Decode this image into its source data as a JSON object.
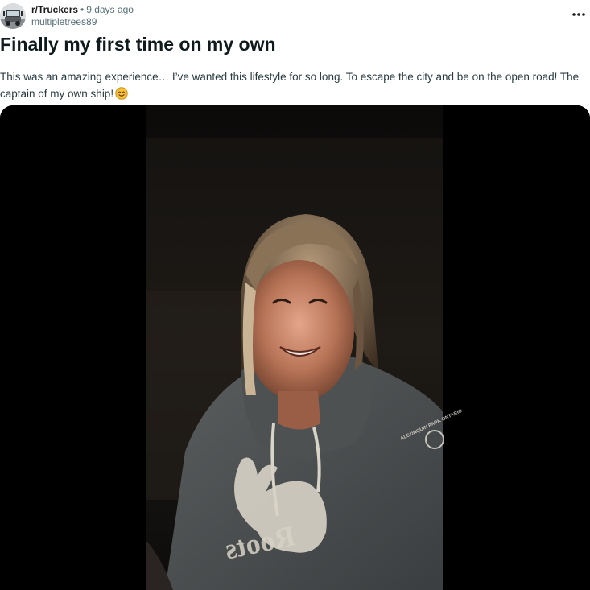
{
  "post": {
    "subreddit": "r/Truckers",
    "separator": "•",
    "time": "9 days ago",
    "username": "multipletrees89",
    "title": "Finally my first time on my own",
    "body": "This was an amazing experience… I’ve wanted this lifestyle for so long. To escape the city and be on the open road! The captain of my own ship!",
    "emoji": "smiling-face-icon"
  },
  "media": {
    "type": "video",
    "hoodie_text": "Roots",
    "badge_text": "ALGONQUIN PARK ONTARIO"
  },
  "colors": {
    "title": "#0f1a1c",
    "meta": "#576f76",
    "media_background": "#000000",
    "emoji": "#f5c33b"
  }
}
